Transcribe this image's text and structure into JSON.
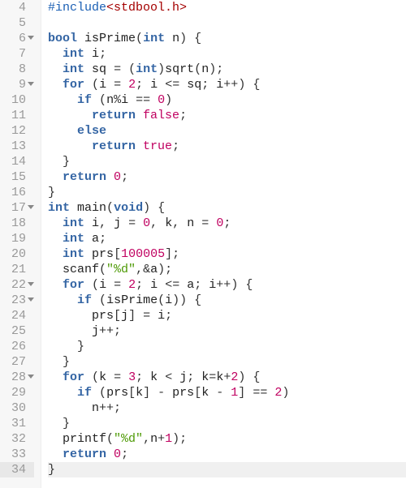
{
  "editor": {
    "lines": [
      {
        "num": 4,
        "fold": false,
        "tokens": [
          [
            "tok-include",
            "#include"
          ],
          [
            "tok-header",
            "<stdbool.h>"
          ]
        ]
      },
      {
        "num": 5,
        "fold": false,
        "tokens": []
      },
      {
        "num": 6,
        "fold": true,
        "tokens": [
          [
            "tok-type",
            "bool"
          ],
          [
            "",
            " "
          ],
          [
            "tok-func",
            "isPrime"
          ],
          [
            "tok-punct",
            "("
          ],
          [
            "tok-type",
            "int"
          ],
          [
            "",
            " "
          ],
          [
            "tok-ident",
            "n"
          ],
          [
            "tok-punct",
            ")"
          ],
          [
            "",
            " "
          ],
          [
            "tok-punct",
            "{"
          ]
        ]
      },
      {
        "num": 7,
        "fold": false,
        "tokens": [
          [
            "",
            "  "
          ],
          [
            "tok-type",
            "int"
          ],
          [
            "",
            " "
          ],
          [
            "tok-ident",
            "i"
          ],
          [
            "tok-punct",
            ";"
          ]
        ]
      },
      {
        "num": 8,
        "fold": false,
        "tokens": [
          [
            "",
            "  "
          ],
          [
            "tok-type",
            "int"
          ],
          [
            "",
            " "
          ],
          [
            "tok-ident",
            "sq"
          ],
          [
            "",
            " "
          ],
          [
            "tok-op",
            "="
          ],
          [
            "",
            " "
          ],
          [
            "tok-punct",
            "("
          ],
          [
            "tok-type",
            "int"
          ],
          [
            "tok-punct",
            ")"
          ],
          [
            "tok-func",
            "sqrt"
          ],
          [
            "tok-punct",
            "("
          ],
          [
            "tok-ident",
            "n"
          ],
          [
            "tok-punct",
            ")"
          ],
          [
            "tok-punct",
            ";"
          ]
        ]
      },
      {
        "num": 9,
        "fold": true,
        "tokens": [
          [
            "",
            "  "
          ],
          [
            "tok-keyword",
            "for"
          ],
          [
            "",
            " "
          ],
          [
            "tok-punct",
            "("
          ],
          [
            "tok-ident",
            "i"
          ],
          [
            "",
            " "
          ],
          [
            "tok-op",
            "="
          ],
          [
            "",
            " "
          ],
          [
            "tok-num",
            "2"
          ],
          [
            "tok-punct",
            ";"
          ],
          [
            "",
            " "
          ],
          [
            "tok-ident",
            "i"
          ],
          [
            "",
            " "
          ],
          [
            "tok-op",
            "<="
          ],
          [
            "",
            " "
          ],
          [
            "tok-ident",
            "sq"
          ],
          [
            "tok-punct",
            ";"
          ],
          [
            "",
            " "
          ],
          [
            "tok-ident",
            "i"
          ],
          [
            "tok-op",
            "++"
          ],
          [
            "tok-punct",
            ")"
          ],
          [
            "",
            " "
          ],
          [
            "tok-punct",
            "{"
          ]
        ]
      },
      {
        "num": 10,
        "fold": false,
        "tokens": [
          [
            "",
            "    "
          ],
          [
            "tok-keyword",
            "if"
          ],
          [
            "",
            " "
          ],
          [
            "tok-punct",
            "("
          ],
          [
            "tok-ident",
            "n"
          ],
          [
            "tok-op",
            "%"
          ],
          [
            "tok-ident",
            "i"
          ],
          [
            "",
            " "
          ],
          [
            "tok-op",
            "=="
          ],
          [
            "",
            " "
          ],
          [
            "tok-num",
            "0"
          ],
          [
            "tok-punct",
            ")"
          ]
        ]
      },
      {
        "num": 11,
        "fold": false,
        "tokens": [
          [
            "",
            "      "
          ],
          [
            "tok-keyword",
            "return"
          ],
          [
            "",
            " "
          ],
          [
            "tok-bool",
            "false"
          ],
          [
            "tok-punct",
            ";"
          ]
        ]
      },
      {
        "num": 12,
        "fold": false,
        "tokens": [
          [
            "",
            "    "
          ],
          [
            "tok-keyword",
            "else"
          ]
        ]
      },
      {
        "num": 13,
        "fold": false,
        "tokens": [
          [
            "",
            "      "
          ],
          [
            "tok-keyword",
            "return"
          ],
          [
            "",
            " "
          ],
          [
            "tok-bool",
            "true"
          ],
          [
            "tok-punct",
            ";"
          ]
        ]
      },
      {
        "num": 14,
        "fold": false,
        "tokens": [
          [
            "",
            "  "
          ],
          [
            "tok-punct",
            "}"
          ]
        ]
      },
      {
        "num": 15,
        "fold": false,
        "tokens": [
          [
            "",
            "  "
          ],
          [
            "tok-keyword",
            "return"
          ],
          [
            "",
            " "
          ],
          [
            "tok-num",
            "0"
          ],
          [
            "tok-punct",
            ";"
          ]
        ]
      },
      {
        "num": 16,
        "fold": false,
        "tokens": [
          [
            "tok-punct",
            "}"
          ]
        ]
      },
      {
        "num": 17,
        "fold": true,
        "tokens": [
          [
            "tok-type",
            "int"
          ],
          [
            "",
            " "
          ],
          [
            "tok-func",
            "main"
          ],
          [
            "tok-punct",
            "("
          ],
          [
            "tok-type",
            "void"
          ],
          [
            "tok-punct",
            ")"
          ],
          [
            "",
            " "
          ],
          [
            "tok-punct",
            "{"
          ]
        ]
      },
      {
        "num": 18,
        "fold": false,
        "tokens": [
          [
            "",
            "  "
          ],
          [
            "tok-type",
            "int"
          ],
          [
            "",
            " "
          ],
          [
            "tok-ident",
            "i"
          ],
          [
            "tok-punct",
            ","
          ],
          [
            "",
            " "
          ],
          [
            "tok-ident",
            "j"
          ],
          [
            "",
            " "
          ],
          [
            "tok-op",
            "="
          ],
          [
            "",
            " "
          ],
          [
            "tok-num",
            "0"
          ],
          [
            "tok-punct",
            ","
          ],
          [
            "",
            " "
          ],
          [
            "tok-ident",
            "k"
          ],
          [
            "tok-punct",
            ","
          ],
          [
            "",
            " "
          ],
          [
            "tok-ident",
            "n"
          ],
          [
            "",
            " "
          ],
          [
            "tok-op",
            "="
          ],
          [
            "",
            " "
          ],
          [
            "tok-num",
            "0"
          ],
          [
            "tok-punct",
            ";"
          ]
        ]
      },
      {
        "num": 19,
        "fold": false,
        "tokens": [
          [
            "",
            "  "
          ],
          [
            "tok-type",
            "int"
          ],
          [
            "",
            " "
          ],
          [
            "tok-ident",
            "a"
          ],
          [
            "tok-punct",
            ";"
          ]
        ]
      },
      {
        "num": 20,
        "fold": false,
        "tokens": [
          [
            "",
            "  "
          ],
          [
            "tok-type",
            "int"
          ],
          [
            "",
            " "
          ],
          [
            "tok-ident",
            "prs"
          ],
          [
            "tok-punct",
            "["
          ],
          [
            "tok-num",
            "100005"
          ],
          [
            "tok-punct",
            "]"
          ],
          [
            "tok-punct",
            ";"
          ]
        ]
      },
      {
        "num": 21,
        "fold": false,
        "tokens": [
          [
            "",
            "  "
          ],
          [
            "tok-func",
            "scanf"
          ],
          [
            "tok-punct",
            "("
          ],
          [
            "tok-string",
            "\"%d\""
          ],
          [
            "tok-punct",
            ","
          ],
          [
            "tok-op",
            "&"
          ],
          [
            "tok-ident",
            "a"
          ],
          [
            "tok-punct",
            ")"
          ],
          [
            "tok-punct",
            ";"
          ]
        ]
      },
      {
        "num": 22,
        "fold": true,
        "tokens": [
          [
            "",
            "  "
          ],
          [
            "tok-keyword",
            "for"
          ],
          [
            "",
            " "
          ],
          [
            "tok-punct",
            "("
          ],
          [
            "tok-ident",
            "i"
          ],
          [
            "",
            " "
          ],
          [
            "tok-op",
            "="
          ],
          [
            "",
            " "
          ],
          [
            "tok-num",
            "2"
          ],
          [
            "tok-punct",
            ";"
          ],
          [
            "",
            " "
          ],
          [
            "tok-ident",
            "i"
          ],
          [
            "",
            " "
          ],
          [
            "tok-op",
            "<="
          ],
          [
            "",
            " "
          ],
          [
            "tok-ident",
            "a"
          ],
          [
            "tok-punct",
            ";"
          ],
          [
            "",
            " "
          ],
          [
            "tok-ident",
            "i"
          ],
          [
            "tok-op",
            "++"
          ],
          [
            "tok-punct",
            ")"
          ],
          [
            "",
            " "
          ],
          [
            "tok-punct",
            "{"
          ]
        ]
      },
      {
        "num": 23,
        "fold": true,
        "tokens": [
          [
            "",
            "    "
          ],
          [
            "tok-keyword",
            "if"
          ],
          [
            "",
            " "
          ],
          [
            "tok-punct",
            "("
          ],
          [
            "tok-func",
            "isPrime"
          ],
          [
            "tok-punct",
            "("
          ],
          [
            "tok-ident",
            "i"
          ],
          [
            "tok-punct",
            ")"
          ],
          [
            "tok-punct",
            ")"
          ],
          [
            "",
            " "
          ],
          [
            "tok-punct",
            "{"
          ]
        ]
      },
      {
        "num": 24,
        "fold": false,
        "tokens": [
          [
            "",
            "      "
          ],
          [
            "tok-ident",
            "prs"
          ],
          [
            "tok-punct",
            "["
          ],
          [
            "tok-ident",
            "j"
          ],
          [
            "tok-punct",
            "]"
          ],
          [
            "",
            " "
          ],
          [
            "tok-op",
            "="
          ],
          [
            "",
            " "
          ],
          [
            "tok-ident",
            "i"
          ],
          [
            "tok-punct",
            ";"
          ]
        ]
      },
      {
        "num": 25,
        "fold": false,
        "tokens": [
          [
            "",
            "      "
          ],
          [
            "tok-ident",
            "j"
          ],
          [
            "tok-op",
            "++"
          ],
          [
            "tok-punct",
            ";"
          ]
        ]
      },
      {
        "num": 26,
        "fold": false,
        "tokens": [
          [
            "",
            "    "
          ],
          [
            "tok-punct",
            "}"
          ]
        ]
      },
      {
        "num": 27,
        "fold": false,
        "tokens": [
          [
            "",
            "  "
          ],
          [
            "tok-punct",
            "}"
          ]
        ]
      },
      {
        "num": 28,
        "fold": true,
        "tokens": [
          [
            "",
            "  "
          ],
          [
            "tok-keyword",
            "for"
          ],
          [
            "",
            " "
          ],
          [
            "tok-punct",
            "("
          ],
          [
            "tok-ident",
            "k"
          ],
          [
            "",
            " "
          ],
          [
            "tok-op",
            "="
          ],
          [
            "",
            " "
          ],
          [
            "tok-num",
            "3"
          ],
          [
            "tok-punct",
            ";"
          ],
          [
            "",
            " "
          ],
          [
            "tok-ident",
            "k"
          ],
          [
            "",
            " "
          ],
          [
            "tok-op",
            "<"
          ],
          [
            "",
            " "
          ],
          [
            "tok-ident",
            "j"
          ],
          [
            "tok-punct",
            ";"
          ],
          [
            "",
            " "
          ],
          [
            "tok-ident",
            "k"
          ],
          [
            "tok-op",
            "="
          ],
          [
            "tok-ident",
            "k"
          ],
          [
            "tok-op",
            "+"
          ],
          [
            "tok-num",
            "2"
          ],
          [
            "tok-punct",
            ")"
          ],
          [
            "",
            " "
          ],
          [
            "tok-punct",
            "{"
          ]
        ]
      },
      {
        "num": 29,
        "fold": false,
        "tokens": [
          [
            "",
            "    "
          ],
          [
            "tok-keyword",
            "if"
          ],
          [
            "",
            " "
          ],
          [
            "tok-punct",
            "("
          ],
          [
            "tok-ident",
            "prs"
          ],
          [
            "tok-punct",
            "["
          ],
          [
            "tok-ident",
            "k"
          ],
          [
            "tok-punct",
            "]"
          ],
          [
            "",
            " "
          ],
          [
            "tok-op",
            "-"
          ],
          [
            "",
            " "
          ],
          [
            "tok-ident",
            "prs"
          ],
          [
            "tok-punct",
            "["
          ],
          [
            "tok-ident",
            "k"
          ],
          [
            "",
            " "
          ],
          [
            "tok-op",
            "-"
          ],
          [
            "",
            " "
          ],
          [
            "tok-num",
            "1"
          ],
          [
            "tok-punct",
            "]"
          ],
          [
            "",
            " "
          ],
          [
            "tok-op",
            "=="
          ],
          [
            "",
            " "
          ],
          [
            "tok-num",
            "2"
          ],
          [
            "tok-punct",
            ")"
          ]
        ]
      },
      {
        "num": 30,
        "fold": false,
        "tokens": [
          [
            "",
            "      "
          ],
          [
            "tok-ident",
            "n"
          ],
          [
            "tok-op",
            "++"
          ],
          [
            "tok-punct",
            ";"
          ]
        ]
      },
      {
        "num": 31,
        "fold": false,
        "tokens": [
          [
            "",
            "  "
          ],
          [
            "tok-punct",
            "}"
          ]
        ]
      },
      {
        "num": 32,
        "fold": false,
        "tokens": [
          [
            "",
            "  "
          ],
          [
            "tok-func",
            "printf"
          ],
          [
            "tok-punct",
            "("
          ],
          [
            "tok-string",
            "\"%d\""
          ],
          [
            "tok-punct",
            ","
          ],
          [
            "tok-ident",
            "n"
          ],
          [
            "tok-op",
            "+"
          ],
          [
            "tok-num",
            "1"
          ],
          [
            "tok-punct",
            ")"
          ],
          [
            "tok-punct",
            ";"
          ]
        ]
      },
      {
        "num": 33,
        "fold": false,
        "tokens": [
          [
            "",
            "  "
          ],
          [
            "tok-keyword",
            "return"
          ],
          [
            "",
            " "
          ],
          [
            "tok-num",
            "0"
          ],
          [
            "tok-punct",
            ";"
          ]
        ]
      },
      {
        "num": 34,
        "fold": false,
        "cursor": true,
        "tokens": [
          [
            "tok-punct",
            "}"
          ]
        ]
      }
    ]
  }
}
